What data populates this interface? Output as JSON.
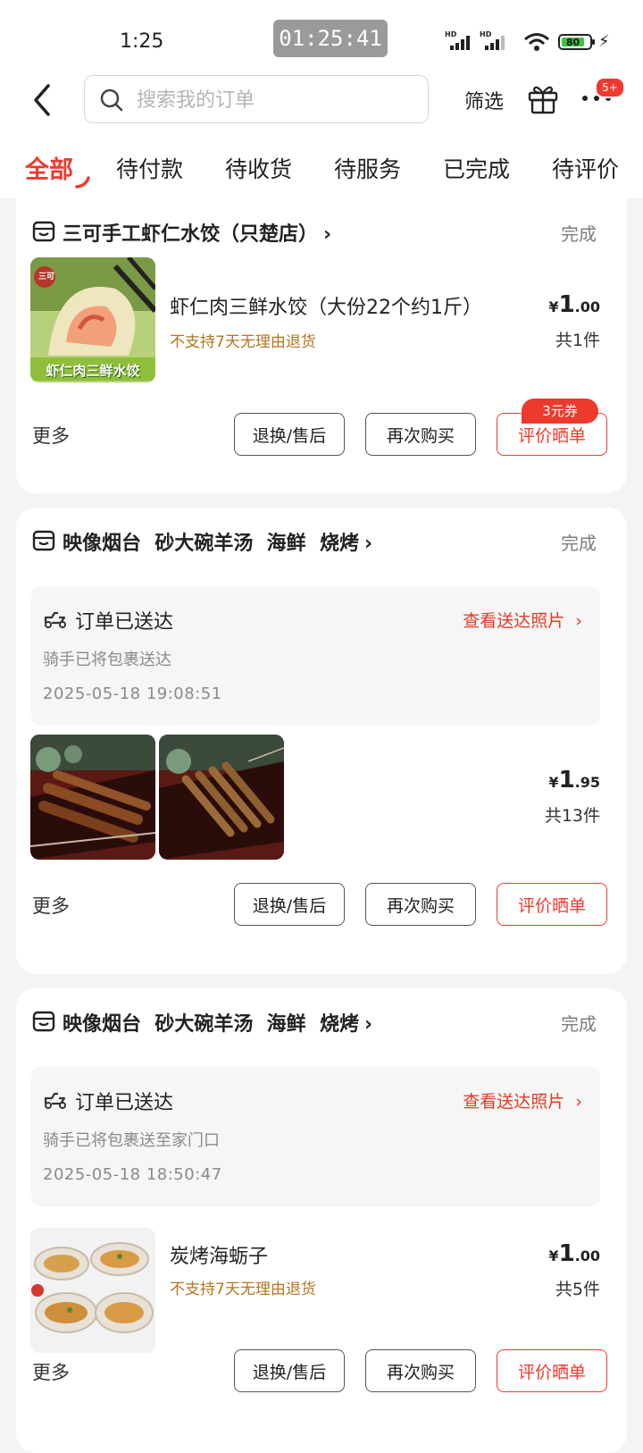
{
  "status_bar": {
    "time": "1:25",
    "timer": "01:25:41",
    "signal_label": "HD",
    "battery": "80"
  },
  "header": {
    "search_placeholder": "搜索我的订单",
    "filter_label": "筛选",
    "badge": "5+"
  },
  "tabs": [
    "全部",
    "待付款",
    "待收货",
    "待服务",
    "已完成",
    "待评价"
  ],
  "orders": [
    {
      "store": "三可手工虾仁水饺（只楚店）",
      "status": "完成",
      "product_name": "虾仁肉三鲜水饺（大份22个约1斤）",
      "notice": "不支持7天无理由退货",
      "price_yen": "¥",
      "price_int": "1",
      "price_dec": ".00",
      "qty": "共1件",
      "thumb_caption": "虾仁肉三鲜水饺",
      "thumb_logo": "三可",
      "more": "更多",
      "buttons": [
        "退换/售后",
        "再次购买",
        "评价晒单"
      ],
      "coupon": "3元券"
    },
    {
      "store": "映像烟台  砂大碗羊汤  海鲜  烧烤",
      "status": "完成",
      "delivery_title": "订单已送达",
      "delivery_link": "查看送达照片",
      "delivery_sub": "骑手已将包裹送达",
      "delivery_time": "2025-05-18 19:08:51",
      "price_yen": "¥",
      "price_int": "1",
      "price_dec": ".95",
      "qty": "共13件",
      "more": "更多",
      "buttons": [
        "退换/售后",
        "再次购买",
        "评价晒单"
      ]
    },
    {
      "store": "映像烟台  砂大碗羊汤  海鲜  烧烤",
      "status": "完成",
      "delivery_title": "订单已送达",
      "delivery_link": "查看送达照片",
      "delivery_sub": "骑手已将包裹送至家门口",
      "delivery_time": "2025-05-18 18:50:47",
      "product_name": "炭烤海蛎子",
      "notice": "不支持7天无理由退货",
      "price_yen": "¥",
      "price_int": "1",
      "price_dec": ".00",
      "qty": "共5件",
      "more": "更多",
      "buttons": [
        "退换/售后",
        "再次购买",
        "评价晒单"
      ]
    }
  ],
  "colors": {
    "accent": "#ec3b2d",
    "notice": "#b4741e",
    "page_bg": "#f4f4f4"
  }
}
